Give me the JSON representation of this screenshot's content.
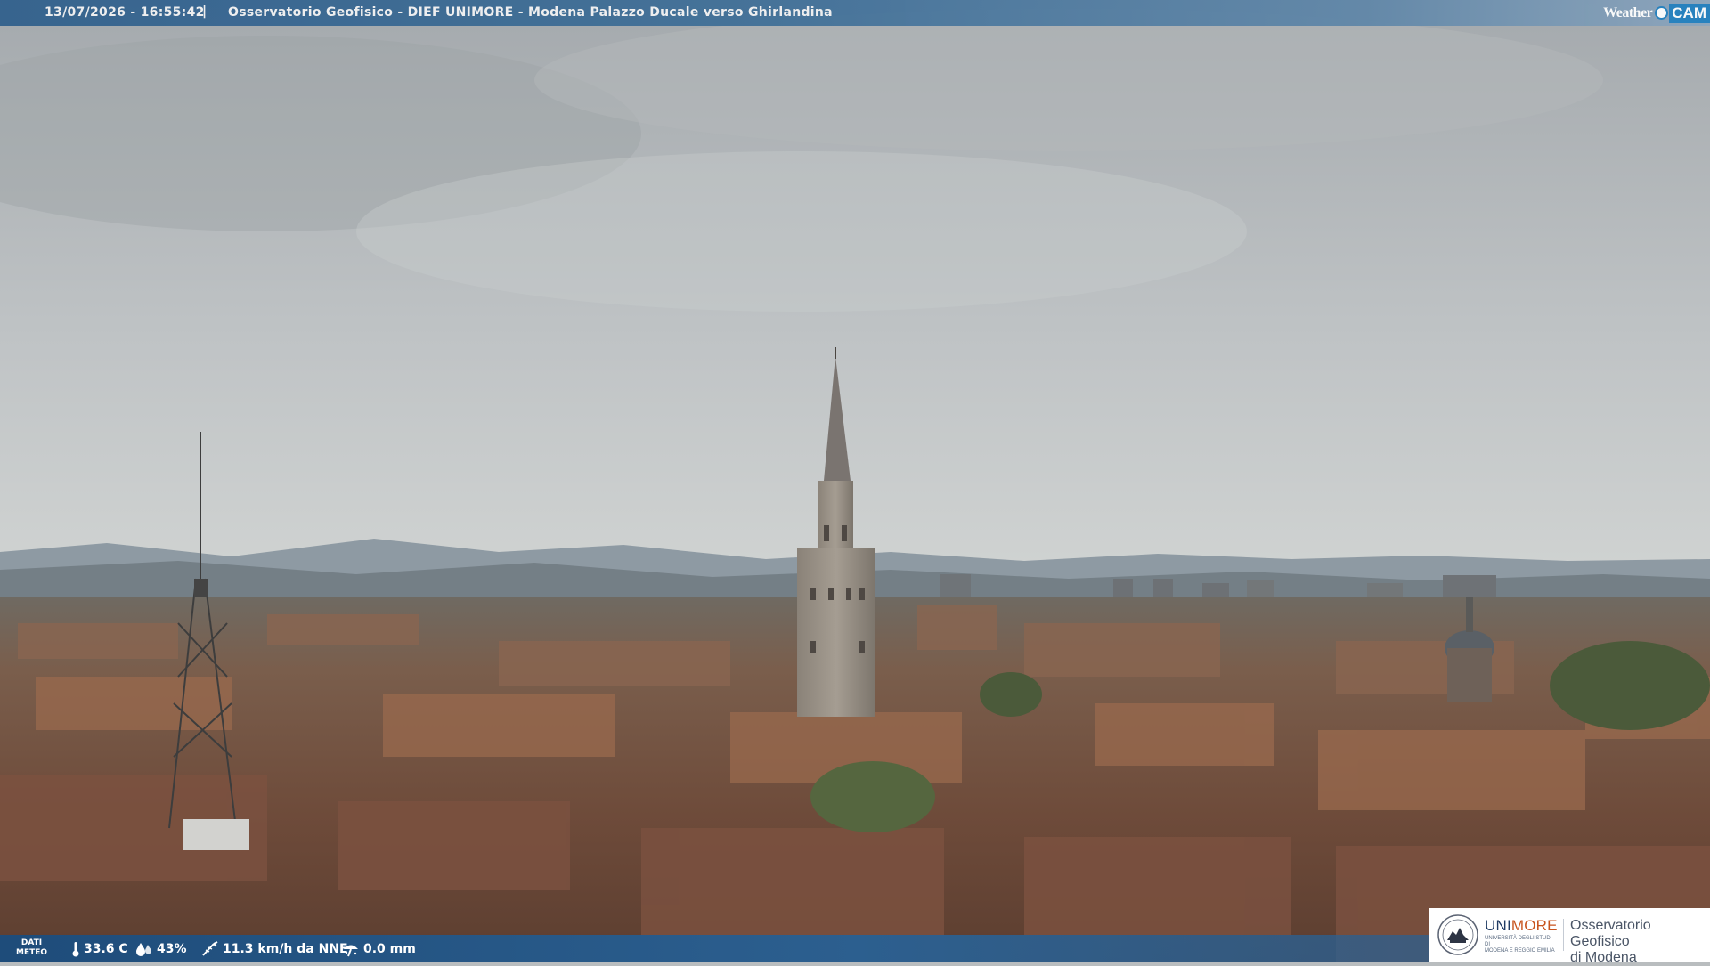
{
  "overlay": {
    "timestamp": "13/07/2026 - 16:55:42",
    "separator": "|",
    "title": "Osservatorio Geofisico - DIEF UNIMORE - Modena Palazzo Ducale verso Ghirlandina",
    "brand_left": "Weather",
    "brand_right": "CAM"
  },
  "weather": {
    "label_line1": "DATI",
    "label_line2": "METEO",
    "temperature": "33.6 C",
    "humidity": "43%",
    "wind": "11.3 km/h da NNE",
    "rain": "0.0 mm",
    "icons": [
      "thermometer-icon",
      "humidity-drop-icon",
      "wind-icon",
      "rain-gauge-icon"
    ]
  },
  "logo": {
    "uni_part": "UNI",
    "more_part": "MORE",
    "sub_line1": "UNIVERSITÀ DEGLI STUDI DI",
    "sub_line2": "MODENA E REGGIO EMILIA",
    "org_line1": "Osservatorio Geofisico",
    "org_line2": "di Modena"
  },
  "colors": {
    "topbar": "#3f6f98",
    "bottombar": "#2c5f8f",
    "brand_blue": "#1f7fc0",
    "more_orange": "#c8541e"
  }
}
